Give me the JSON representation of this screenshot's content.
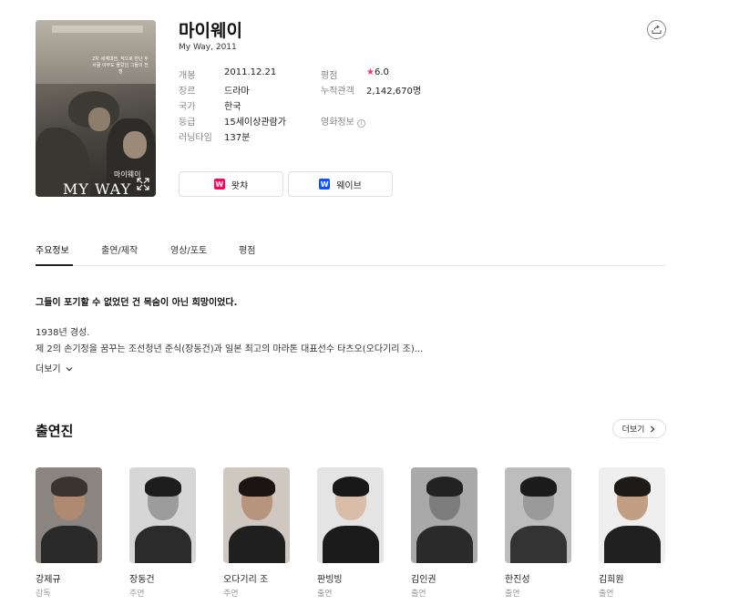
{
  "movie": {
    "title": "마이웨이",
    "subtitle": "My Way, 2011",
    "poster": {
      "tagline": "2차 세계대전, 적으로 만난 두 사람 아무도 몰랐던 그들의 전쟁",
      "kor_title": "마이웨이",
      "logo_text": "MY WAY"
    }
  },
  "info_left": [
    {
      "key": "개봉",
      "value": "2011.12.21"
    },
    {
      "key": "장르",
      "value": "드라마"
    },
    {
      "key": "국가",
      "value": "한국"
    },
    {
      "key": "등급",
      "value": "15세이상관람가"
    },
    {
      "key": "러닝타임",
      "value": "137분"
    }
  ],
  "info_right": [
    {
      "key": "평점",
      "star": "★",
      "value": "6.0"
    },
    {
      "key": "누적관객",
      "value": "2,142,670명"
    },
    {
      "key": "영화정보",
      "help": "i"
    }
  ],
  "ott": [
    {
      "label": "왓챠",
      "icon": "watcha-logo-icon",
      "logo_letter": "W",
      "color": "#ff0558"
    },
    {
      "label": "웨이브",
      "icon": "wavve-logo-icon",
      "logo_letter": "W",
      "color": "#1351f9"
    }
  ],
  "tabs": [
    "주요정보",
    "출연/제작",
    "영상/포토",
    "평점"
  ],
  "synopsis": {
    "tagline": "그들이 포기할 수 없었던 건 목숨이 아닌 희망이었다.",
    "line1": "1938년 경성.",
    "line2": "제 2의 손기정을 꿈꾸는 조선청년 준식(장동건)과 일본 최고의 마라톤 대표선수 타츠오(오다기리 조)...",
    "more_label": "더보기"
  },
  "cast_section": {
    "title": "출연진",
    "more_label": "더보기"
  },
  "cast": [
    {
      "name": "강제규",
      "role": "감독"
    },
    {
      "name": "장동건",
      "role": "주연"
    },
    {
      "name": "오다기리 조",
      "role": "주연"
    },
    {
      "name": "판빙빙",
      "role": "출연"
    },
    {
      "name": "김인권",
      "role": "출연"
    },
    {
      "name": "한진성",
      "role": "출연"
    },
    {
      "name": "김희원",
      "role": "출연"
    }
  ],
  "colors": {
    "star": "#ff2f6e",
    "watcha": "#ff0558",
    "wavve": "#1351f9"
  }
}
